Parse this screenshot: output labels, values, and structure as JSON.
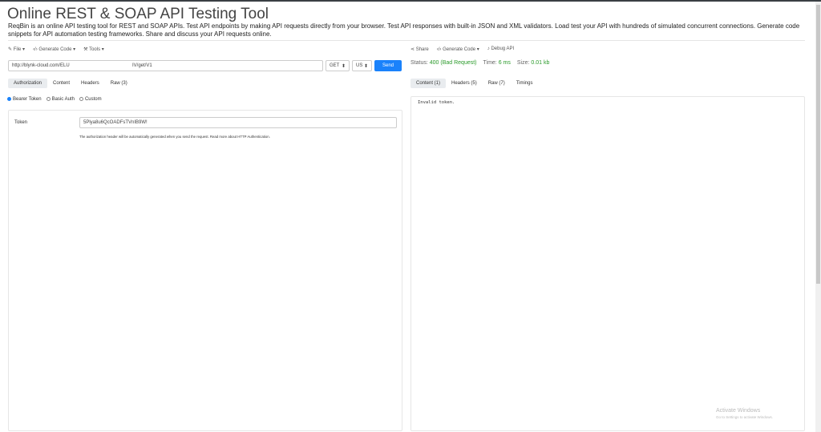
{
  "title": "Online REST & SOAP API Testing Tool",
  "description": "ReqBin is an online API testing tool for REST and SOAP APIs. Test API endpoints by making API requests directly from your browser. Test API responses with built-in JSON and XML validators. Load test your API with hundreds of simulated concurrent connections. Generate code snippets for API automation testing frameworks. Share and discuss your API requests online.",
  "left_toolbar": {
    "file": "File ▾",
    "generate": "Generate Code ▾",
    "tools": "Tools ▾"
  },
  "request": {
    "url": "http://blynk-cloud.com/ELU",
    "url_tail": "IV/get/V1",
    "method": "GET",
    "region": "US",
    "send": "Send"
  },
  "request_tabs": [
    "Authorization",
    "Content",
    "Headers",
    "Raw (3)"
  ],
  "auth": {
    "options": [
      "Bearer Token",
      "Basic Auth",
      "Custom"
    ],
    "selected": "Bearer Token",
    "token_label": "Token",
    "token_value": "5Plya8u6QcOADFsTVnIB9W!",
    "help": "The authorization header will be automatically generated when you send the request. Read more about HTTP Authentication."
  },
  "right_toolbar": {
    "share": "Share",
    "generate": "Generate Code ▾",
    "debug": "Debug API"
  },
  "status": {
    "status_label": "Status:",
    "status_value": "400 (Bad Request)",
    "time_label": "Time:",
    "time_value": "6 ms",
    "size_label": "Size:",
    "size_value": "0.01 kb"
  },
  "response_tabs": [
    "Content (1)",
    "Headers (5)",
    "Raw (7)",
    "Timings"
  ],
  "response_body": "Invalid token.",
  "watermark": {
    "title": "Activate Windows",
    "subtitle": "Go to Settings to activate Windows."
  },
  "colors": {
    "accent": "#1a82fb",
    "success": "#2a9a2a"
  }
}
